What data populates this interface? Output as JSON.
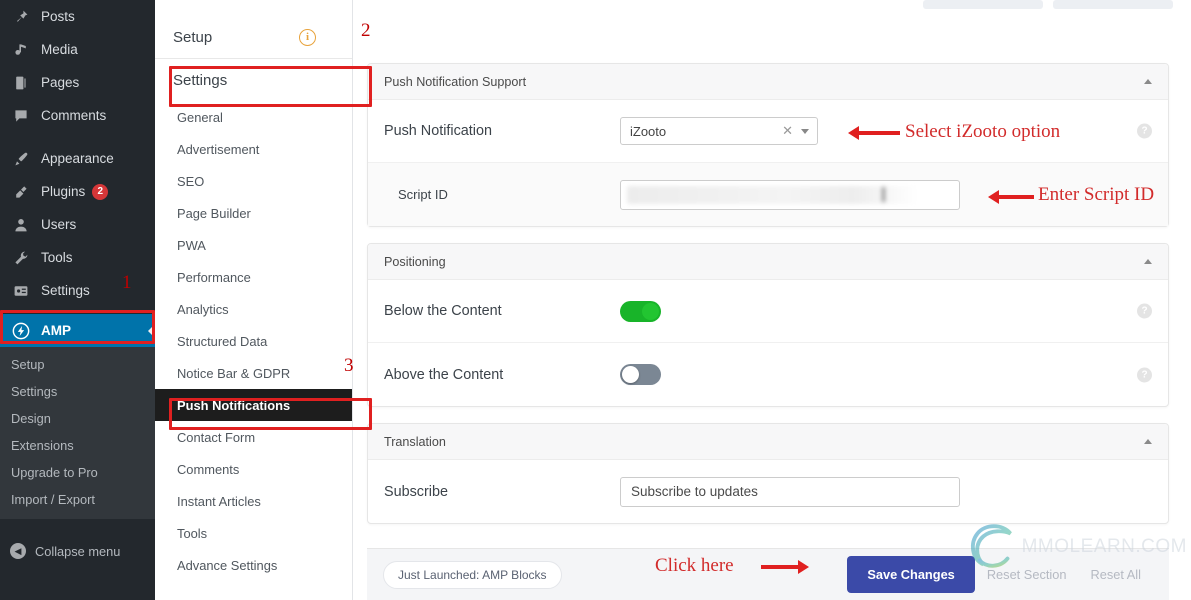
{
  "wp_sidebar": {
    "items": [
      {
        "label": "Posts",
        "icon": "pin-icon",
        "badge": null
      },
      {
        "label": "Media",
        "icon": "media-icon",
        "badge": null
      },
      {
        "label": "Pages",
        "icon": "page-icon",
        "badge": null
      },
      {
        "label": "Comments",
        "icon": "comment-icon",
        "badge": null
      },
      {
        "label": "Appearance",
        "icon": "brush-icon",
        "badge": null
      },
      {
        "label": "Plugins",
        "icon": "plug-icon",
        "badge": "2"
      },
      {
        "label": "Users",
        "icon": "user-icon",
        "badge": null
      },
      {
        "label": "Tools",
        "icon": "wrench-icon",
        "badge": null
      },
      {
        "label": "Settings",
        "icon": "sliders-icon",
        "badge": null
      }
    ],
    "current": {
      "label": "AMP",
      "icon": "amp-bolt-icon"
    },
    "submenu": [
      "Setup",
      "Settings",
      "Design",
      "Extensions",
      "Upgrade to Pro",
      "Import / Export"
    ],
    "collapse_label": "Collapse menu"
  },
  "plugin_nav": {
    "setup_label": "Setup",
    "setup_info_icon": "info-circle-icon",
    "settings_label": "Settings",
    "items": [
      "General",
      "Advertisement",
      "SEO",
      "Page Builder",
      "PWA",
      "Performance",
      "Analytics",
      "Structured Data",
      "Notice Bar & GDPR",
      "Push Notifications",
      "Contact Form",
      "Comments",
      "Instant Articles",
      "Tools",
      "Advance Settings"
    ],
    "active_item": "Push Notifications"
  },
  "sections": {
    "push": {
      "title": "Push Notification Support",
      "collapse_icon": "chevron-up-icon",
      "push_notification": {
        "label": "Push Notification",
        "value": "iZooto",
        "clear_icon": "clear-x-icon",
        "caret_icon": "chevron-down-icon",
        "help_icon": "question-mark-icon"
      },
      "script_id": {
        "label": "Script ID",
        "value": ""
      }
    },
    "positioning": {
      "title": "Positioning",
      "collapse_icon": "chevron-up-icon",
      "rows": [
        {
          "label": "Below the Content",
          "state": "on",
          "help_icon": "question-mark-icon"
        },
        {
          "label": "Above the Content",
          "state": "off",
          "help_icon": "question-mark-icon"
        }
      ]
    },
    "translation": {
      "title": "Translation",
      "collapse_icon": "chevron-up-icon",
      "subscribe": {
        "label": "Subscribe",
        "value": "Subscribe to updates"
      }
    }
  },
  "bottom_bar": {
    "badge": "Just Launched: AMP Blocks",
    "save_label": "Save Changes",
    "reset_section_label": "Reset Section",
    "reset_all_label": "Reset All"
  },
  "annotations": {
    "num_settings": "1",
    "num_setup": "2",
    "num_push": "3",
    "select_izooto": "Select iZooto option",
    "enter_script_id": "Enter Script ID",
    "click_here": "Click here"
  },
  "watermark": {
    "text": "MMOLEARN.COM",
    "logo_icon": "swirl-logo-icon",
    "colors": {
      "start": "#2e8fd0",
      "mid": "#3fb5a0",
      "end": "#7fc241"
    }
  },
  "colors": {
    "wp_sidebar_bg": "#23282d",
    "wp_submenu_bg": "#32373c",
    "wp_current_blue": "#0073aa",
    "annotation_red": "#d22b2b",
    "highlight_red": "#e02020",
    "save_button": "#3b4aa8",
    "toggle_on": "#18b429",
    "toggle_off": "#7b8794",
    "info_orange": "#e8a33d"
  }
}
